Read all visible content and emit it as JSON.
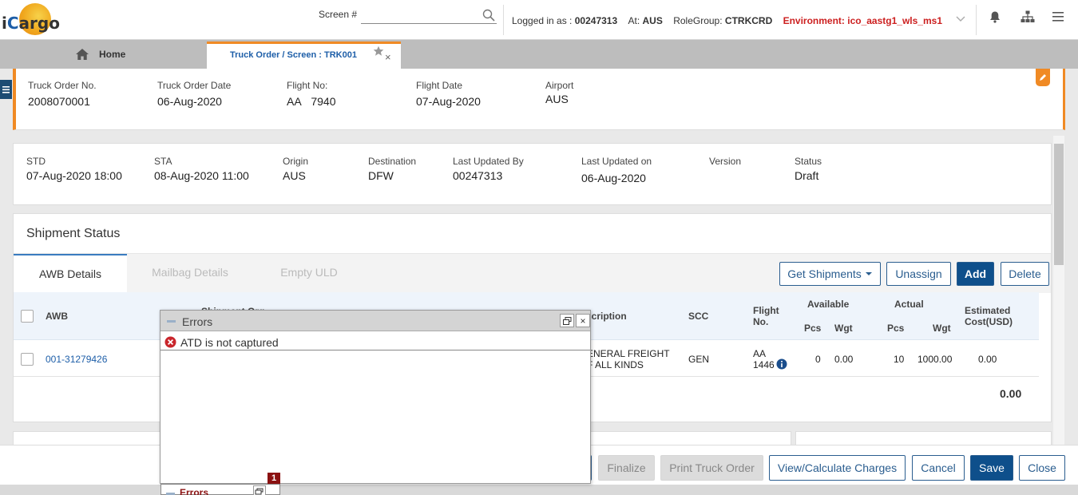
{
  "header": {
    "logo_text_prefix": "i",
    "logo_text_c": "C",
    "logo_text_rest": "argo",
    "screen_label": "Screen #",
    "screen_value": "",
    "logged_label": "Logged in as :",
    "logged_user": "00247313",
    "at_label": "At:",
    "at_value": "AUS",
    "role_label": "RoleGroup:",
    "role_value": "CTRKCRD",
    "environment": "Environment: ico_aastg1_wls_ms1"
  },
  "tabs": {
    "home": "Home",
    "active": "Truck Order / Screen : TRK001",
    "close": "×"
  },
  "order": {
    "truck_order_no_label": "Truck Order No.",
    "truck_order_no": "2008070001",
    "truck_order_date_label": "Truck Order Date",
    "truck_order_date": "06-Aug-2020",
    "flight_no_label": "Flight No:",
    "flight_carrier": "AA",
    "flight_number": "7940",
    "flight_date_label": "Flight Date",
    "flight_date": "07-Aug-2020",
    "airport_label": "Airport",
    "airport": "AUS"
  },
  "details": {
    "std_label": "STD",
    "std": "07-Aug-2020 18:00",
    "sta_label": "STA",
    "sta": "08-Aug-2020 11:00",
    "origin_label": "Origin",
    "origin": "AUS",
    "destination_label": "Destination",
    "destination": "DFW",
    "updated_by_label": "Last Updated By",
    "updated_by": "00247313",
    "updated_on_label": "Last Updated on",
    "updated_on": "06-Aug-2020",
    "version_label": "Version",
    "version": "",
    "status_label": "Status",
    "status": "Draft"
  },
  "shipment": {
    "title": "Shipment Status",
    "tabs": [
      "AWB Details",
      "Mailbag Details",
      "Empty ULD"
    ],
    "buttons": {
      "get_shipments": "Get Shipments",
      "unassign": "Unassign",
      "add": "Add",
      "delete": "Delete"
    },
    "columns": {
      "awb": "AWB",
      "shipment_org": "Shipment Org",
      "description": "scription",
      "scc": "SCC",
      "flight_no_1": "Flight",
      "flight_no_2": "No.",
      "available": "Available",
      "actual": "Actual",
      "pcs": "Pcs",
      "wgt": "Wgt",
      "est_cost_1": "Estimated",
      "est_cost_2": "Cost(USD)"
    },
    "rows": [
      {
        "awb": "001-31279426",
        "description_1": "ENERAL FREIGHT",
        "description_2": "F ALL KINDS",
        "scc": "GEN",
        "flight_1": "AA",
        "flight_2": "1446",
        "avail_pcs": "0",
        "avail_wgt": "0.00",
        "actual_pcs": "10",
        "actual_wgt": "1000.00",
        "est_cost": "0.00"
      }
    ],
    "total": "0.00"
  },
  "footer": {
    "finalize": "Finalize",
    "print": "Print Truck Order",
    "charges": "View/Calculate Charges",
    "cancel": "Cancel",
    "save": "Save",
    "close": "Close"
  },
  "error_dialog": {
    "title": "Errors",
    "message": "ATD is not captured",
    "close": "×",
    "minimized_title": "Errors",
    "badge_count": "1"
  },
  "colors": {
    "accent_orange": "#f08a24",
    "primary_blue": "#0e4f8b",
    "link_blue": "#1d5ea8",
    "env_red": "#cc1f1f",
    "error_red": "#c9262c"
  }
}
